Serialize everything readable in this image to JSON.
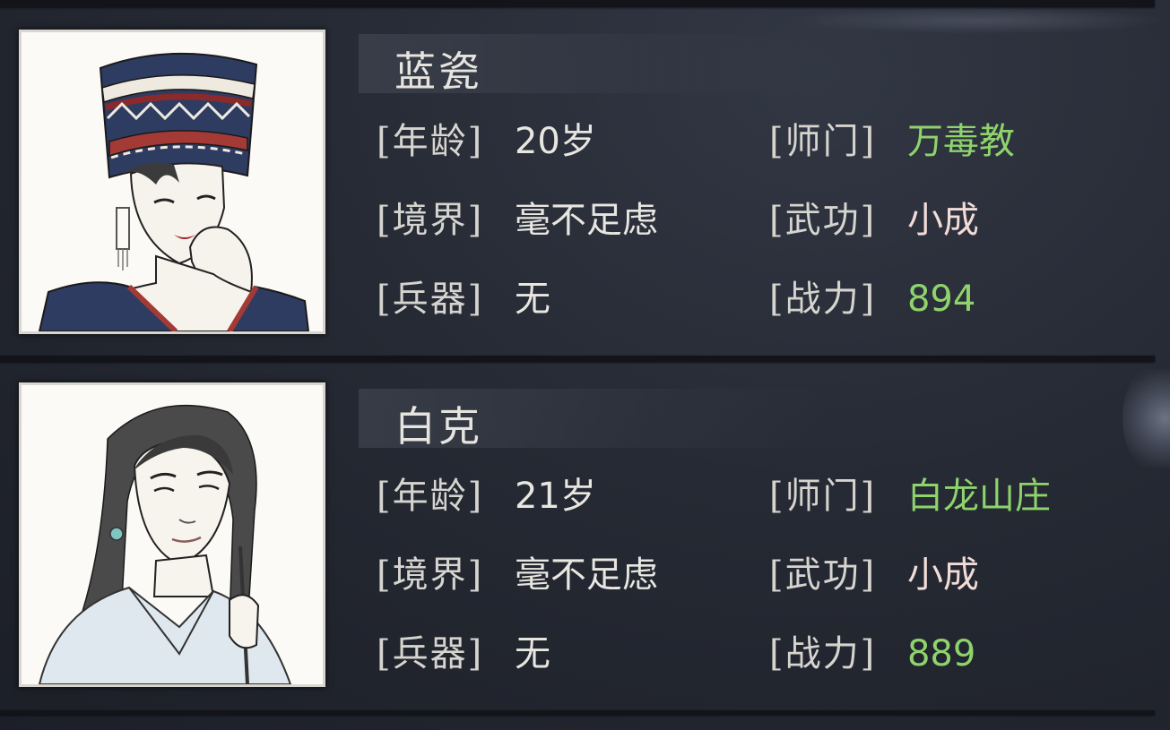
{
  "labels": {
    "age": "[年龄]",
    "realm": "[境界]",
    "weapon": "[兵器]",
    "sect": "[师门]",
    "martial": "[武功]",
    "power": "[战力]"
  },
  "characters": [
    {
      "name": "蓝瓷",
      "age": "20岁",
      "realm": "毫不足虑",
      "weapon": "无",
      "sect": "万毒教",
      "martial": "小成",
      "power": "894",
      "portrait_icon": "woman-with-miao-headdress-portrait"
    },
    {
      "name": "白克",
      "age": "21岁",
      "realm": "毫不足虑",
      "weapon": "无",
      "sect": "白龙山庄",
      "martial": "小成",
      "power": "889",
      "portrait_icon": "long-haired-man-portrait"
    }
  ],
  "colors": {
    "background": "#262a34",
    "highlight_green": "#8ed36c",
    "pink_text": "#f2dcd8",
    "label_text": "#d6d4cf"
  }
}
